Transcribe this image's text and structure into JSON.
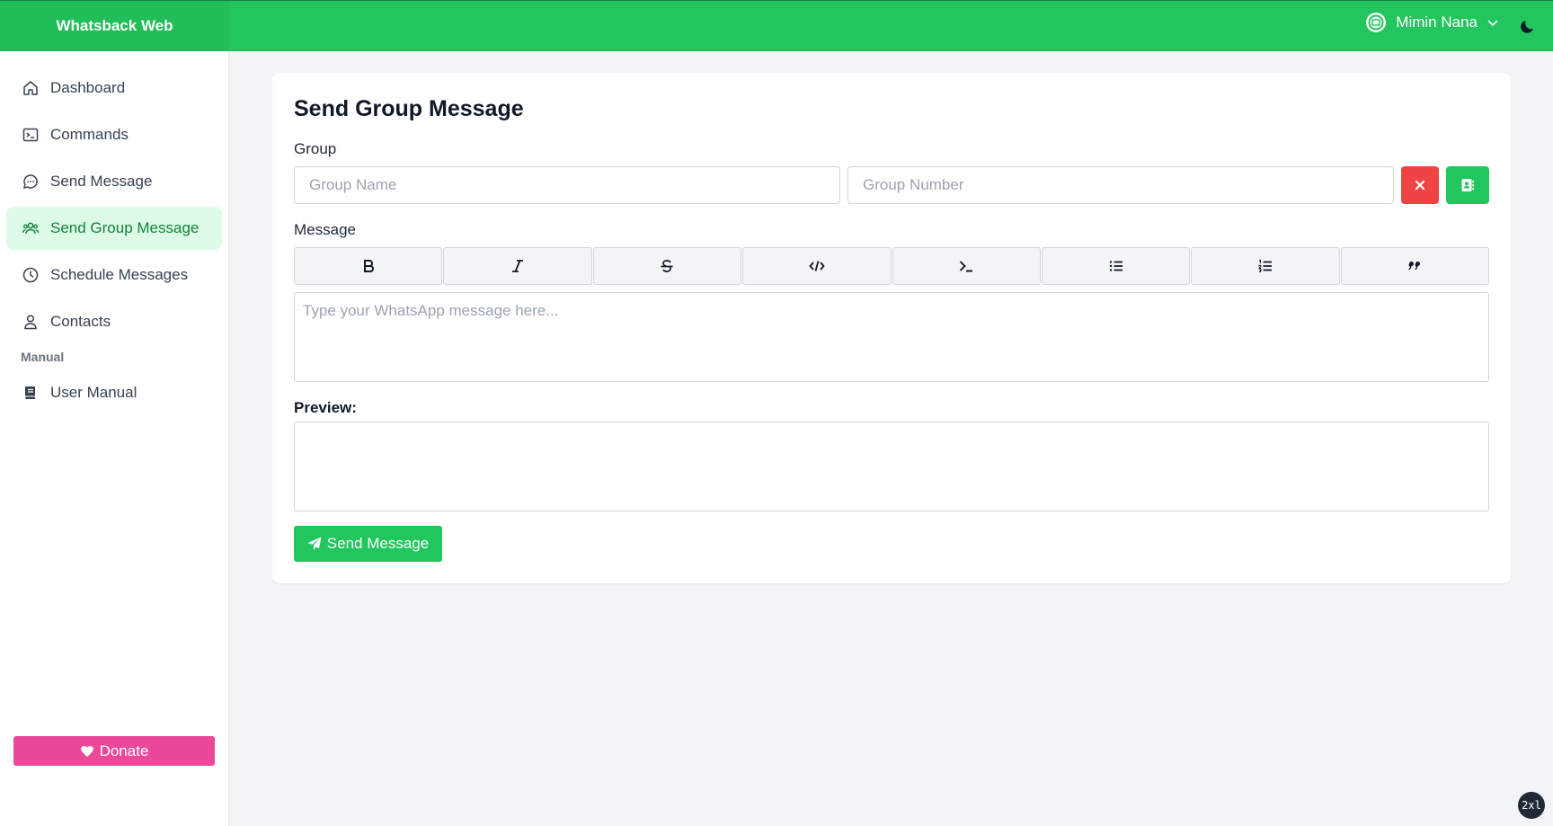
{
  "brand": "Whatsback Web",
  "user": {
    "name": "Mimin Nana"
  },
  "sidebar": {
    "items": [
      {
        "label": "Dashboard",
        "icon": "home-icon"
      },
      {
        "label": "Commands",
        "icon": "terminal-icon"
      },
      {
        "label": "Send Message",
        "icon": "chat-icon"
      },
      {
        "label": "Send Group Message",
        "icon": "users-icon",
        "active": true
      },
      {
        "label": "Schedule Messages",
        "icon": "clock-icon"
      },
      {
        "label": "Contacts",
        "icon": "user-icon"
      }
    ],
    "section_label": "Manual",
    "manual_item": {
      "label": "User Manual",
      "icon": "book-icon"
    },
    "donate_label": "Donate"
  },
  "main": {
    "title": "Send Group Message",
    "group_label": "Group",
    "group_name_placeholder": "Group Name",
    "group_number_placeholder": "Group Number",
    "message_label": "Message",
    "toolbar": [
      "bold",
      "italic",
      "strikethrough",
      "code",
      "monospace",
      "bullet-list",
      "numbered-list",
      "quote"
    ],
    "message_placeholder": "Type your WhatsApp message here...",
    "preview_label": "Preview:",
    "send_label": "Send Message"
  },
  "badge": "2xl",
  "colors": {
    "primary": "#22c55e",
    "danger": "#ef4444",
    "donate": "#ec4899",
    "active_bg": "#dcfce7"
  }
}
